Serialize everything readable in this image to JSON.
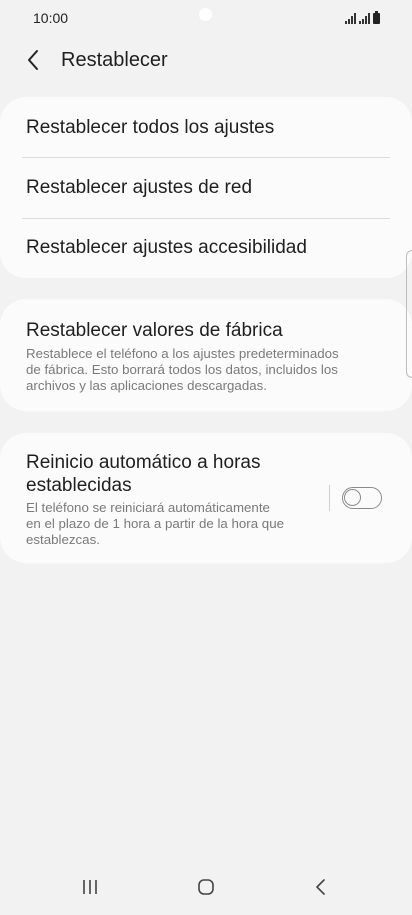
{
  "status_bar": {
    "time": "10:00"
  },
  "header": {
    "title": "Restablecer",
    "back_icon": "chevron-left-icon"
  },
  "reset_options": [
    {
      "label": "Restablecer todos los ajustes"
    },
    {
      "label": "Restablecer ajustes de red"
    },
    {
      "label": "Restablecer ajustes accesibilidad"
    }
  ],
  "factory_reset": {
    "title": "Restablecer valores de fábrica",
    "description_lines": [
      "Restablece el teléfono a los ajustes predeterminados",
      "de fábrica. Esto borrará todos los datos, incluidos los",
      "archivos y las aplicaciones descargadas."
    ]
  },
  "auto_restart": {
    "title_lines": [
      "Reinicio automático a horas",
      "establecidas"
    ],
    "description_lines": [
      "El teléfono se reiniciará automáticamente",
      "en el plazo de 1 hora a partir de la hora que",
      "establezcas."
    ],
    "toggle_on": false
  },
  "navbar": {
    "icons": [
      "recents-icon",
      "home-icon",
      "back-icon"
    ]
  },
  "colors": {
    "background": "#f2f2f2",
    "card": "#fbfbfb",
    "secondary_text": "#7a7a7a"
  }
}
